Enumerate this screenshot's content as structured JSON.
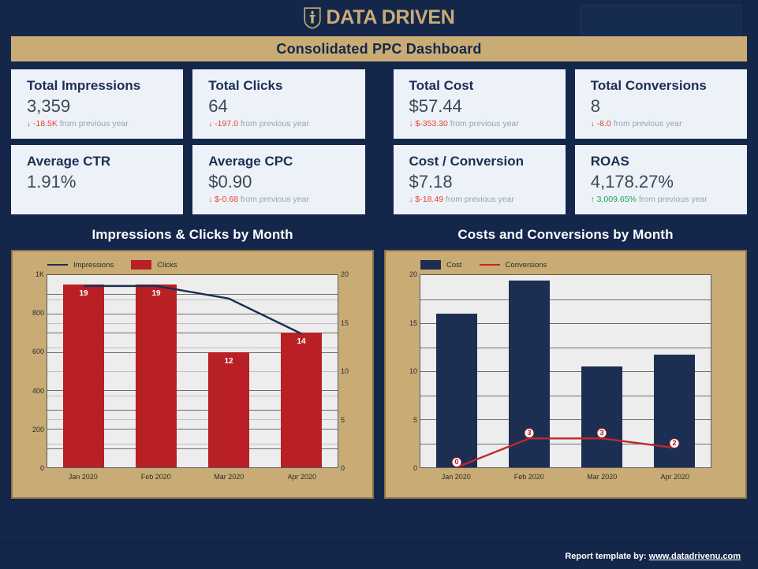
{
  "brand": {
    "name": "DATA DRIVEN",
    "logo_icon": "shield-torch-icon",
    "gold": "#C9AC75",
    "navy": "#14274A"
  },
  "title_bar": {
    "text": "Consolidated PPC Dashboard"
  },
  "kpis": [
    {
      "title": "Total Impressions",
      "value": "3,359",
      "delta_arrow": "↓",
      "delta_amount": "-18.5K",
      "delta_suffix": "from previous year",
      "direction": "down"
    },
    {
      "title": "Total Clicks",
      "value": "64",
      "delta_arrow": "↓",
      "delta_amount": "-197.0",
      "delta_suffix": "from previous year",
      "direction": "down"
    },
    {
      "title": "Total Cost",
      "value": "$57.44",
      "delta_arrow": "↓",
      "delta_amount": "$-353.30",
      "delta_suffix": "from previous year",
      "direction": "down"
    },
    {
      "title": "Total Conversions",
      "value": "8",
      "delta_arrow": "↓",
      "delta_amount": "-8.0",
      "delta_suffix": "from previous year",
      "direction": "down"
    },
    {
      "title": "Average CTR",
      "value": "1.91%",
      "delta_arrow": "",
      "delta_amount": "",
      "delta_suffix": "",
      "direction": "none"
    },
    {
      "title": "Average CPC",
      "value": "$0.90",
      "delta_arrow": "↓",
      "delta_amount": "$-0.68",
      "delta_suffix": "from previous year",
      "direction": "down"
    },
    {
      "title": "Cost / Conversion",
      "value": "$7.18",
      "delta_arrow": "↓",
      "delta_amount": "$-18.49",
      "delta_suffix": "from previous year",
      "direction": "down"
    },
    {
      "title": "ROAS",
      "value": "4,178.27%",
      "delta_arrow": "↑",
      "delta_amount": "3,009.65%",
      "delta_suffix": "from previous year",
      "direction": "up"
    }
  ],
  "chart_data": [
    {
      "type": "bar",
      "title": "Impressions & Clicks by Month",
      "categories": [
        "Jan 2020",
        "Feb 2020",
        "Mar 2020",
        "Apr 2020"
      ],
      "series": [
        {
          "name": "Clicks",
          "type": "bar",
          "axis": "right",
          "values": [
            19,
            19,
            12,
            14
          ],
          "color": "#B82025",
          "show_labels": true
        },
        {
          "name": "Impressions",
          "type": "line",
          "axis": "left",
          "values": [
            940,
            940,
            880,
            700
          ],
          "color": "#1C2F52",
          "show_labels": false
        }
      ],
      "legend": [
        "Impressions",
        "Clicks"
      ],
      "legend_position": "top-left",
      "xlabel": "",
      "ylabel_left": "",
      "ylabel_right": "",
      "ylim_left": [
        0,
        1000
      ],
      "ylim_right": [
        0,
        20
      ],
      "yticks_left": [
        "0",
        "200",
        "400",
        "600",
        "800",
        "1K"
      ],
      "yticks_right": [
        "0",
        "5",
        "10",
        "15",
        "20"
      ],
      "grid": true
    },
    {
      "type": "bar",
      "title": "Costs and Conversions by Month",
      "categories": [
        "Jan 2020",
        "Feb 2020",
        "Mar 2020",
        "Apr 2020"
      ],
      "series": [
        {
          "name": "Cost",
          "type": "bar",
          "axis": "left",
          "values": [
            16.0,
            19.4,
            10.5,
            11.7
          ],
          "color": "#1C2F52",
          "show_labels": false
        },
        {
          "name": "Conversions",
          "type": "line",
          "axis": "left",
          "values": [
            0,
            3,
            3,
            2
          ],
          "color": "#C0282D",
          "show_labels": true
        }
      ],
      "legend": [
        "Cost",
        "Conversions"
      ],
      "legend_position": "top-left",
      "xlabel": "",
      "ylabel_left": "",
      "ylim_left": [
        0,
        20
      ],
      "yticks_left": [
        "0",
        "5",
        "10",
        "15",
        "20"
      ],
      "grid": true
    }
  ],
  "footer": {
    "text": "Report template by:",
    "link_text": "www.datadrivenu.com"
  }
}
